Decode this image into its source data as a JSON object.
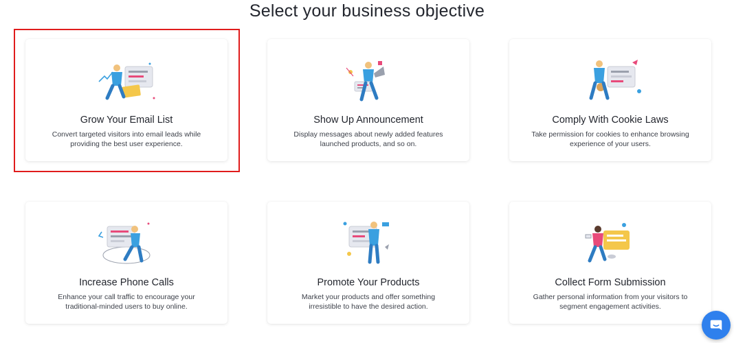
{
  "page": {
    "title": "Select your business objective"
  },
  "cards": [
    {
      "title": "Grow Your Email List",
      "desc": "Convert targeted visitors into email leads while providing the best user experience."
    },
    {
      "title": "Show Up Announcement",
      "desc": "Display messages about newly added features launched products, and so on."
    },
    {
      "title": "Comply With Cookie Laws",
      "desc": "Take permission for cookies to enhance browsing experience of your users."
    },
    {
      "title": "Increase Phone Calls",
      "desc": "Enhance your call traffic to encourage your traditional-minded users to buy online."
    },
    {
      "title": "Promote Your Products",
      "desc": "Market your products and offer something irresistible to have the desired action."
    },
    {
      "title": "Collect Form Submission",
      "desc": "Gather personal information from your visitors to segment engagement activities."
    }
  ],
  "selected_card": "Grow Your Email List",
  "colors": {
    "accent": "#2f80ed",
    "highlight": "#e01b1b",
    "figure_shirt": "#3aa0e0",
    "figure_pants": "#2e7cc2",
    "pink": "#e84a7a",
    "yellow": "#f4c74a"
  },
  "icons": {
    "chat": "chat-bubble-icon"
  }
}
